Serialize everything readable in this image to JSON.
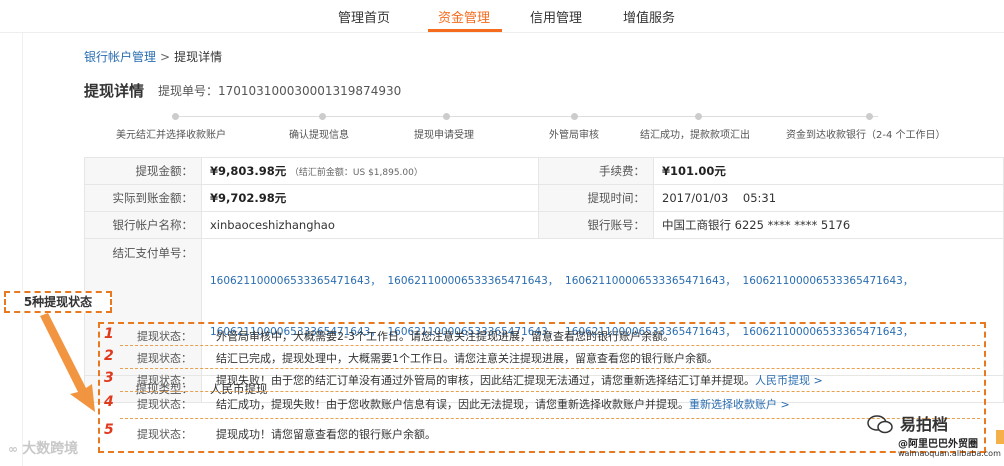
{
  "nav": {
    "tabs": [
      {
        "label": "管理首页"
      },
      {
        "label": "资金管理"
      },
      {
        "label": "信用管理"
      },
      {
        "label": "增值服务"
      }
    ],
    "active_color": "#f56c1e"
  },
  "breadcrumb": {
    "parent": "银行帐户管理",
    "separator": ">",
    "current": "提现详情"
  },
  "title": "提现详情",
  "order_no": "提现单号：17010310003000131987​4930",
  "steps": [
    "美元结汇并选择收款账户",
    "确认提现信息",
    "提现申请受理",
    "外管局审核",
    "结汇成功，提款款项汇出",
    "资金到达收款银行（2-4 个工作日）"
  ],
  "info": {
    "amount_label": "提现金额：",
    "amount_value": "¥9,803.98元",
    "amount_note": "（结汇前金额：US $1,895.00）",
    "fee_label": "手续费：",
    "fee_value": "¥101.00元",
    "actual_label": "实际到账金额：",
    "actual_value": "¥9,702.98元",
    "time_label": "提现时间：",
    "time_value": "2017/01/03    05:31",
    "account_name_label": "银行帐户名称：",
    "account_name_value": "xinbaoceshizhanghao",
    "account_no_label": "银行账号：",
    "account_no_value": "中国工商银行 6225 **** **** 5176",
    "serial_label": "结汇支付单号：",
    "serial_line1": "16062110000653336547​1643，  16062110000653336547​1643，  16062110000653336547​1643，  16062110000653336547​1643，",
    "serial_line2": "16062110000653336547​1643，  16062110000653336547​1643，  16062110000653336547​1643，  16062110000653336547​1643，",
    "type_label": "提现类型：",
    "type_value": "人民币提现"
  },
  "callout": "5种提现状态",
  "statuses": [
    {
      "num": "1",
      "label": "提现状态：",
      "text": "外管局审核中，大概需要2-3个工作日。请您注意关注提现进展，留意查看您的银行账户余额。",
      "link": ""
    },
    {
      "num": "2",
      "label": "提现状态：",
      "text": "结汇已完成，提现处理中，大概需要1个工作日。请您注意关注提现进展，留意查看您的银行账户余额。",
      "link": ""
    },
    {
      "num": "3",
      "label": "提现状态：",
      "text": "提现失败！由于您的结汇订单没有通过外管局的审核，因此结汇提现无法通过，请您重新选择结汇订单并提现。",
      "link": "人民币提现 >"
    },
    {
      "num": "4",
      "label": "提现状态：",
      "text": "结汇成功，提现失败！由于您收款账户信息有误，因此无法提现，请您重新选择收款账户并提现。",
      "link": "重新选择收款账户 >"
    },
    {
      "num": "5",
      "label": "提现状态：",
      "text": "提现成功！请您留意查看您的银行账户余额。",
      "link": ""
    }
  ],
  "watermarks": {
    "left": "大数跨境",
    "right_title": "易拍档",
    "right_sub": "@阿里巴巴外贸圈",
    "right_url": "waimaoquan.alibaba.com"
  }
}
